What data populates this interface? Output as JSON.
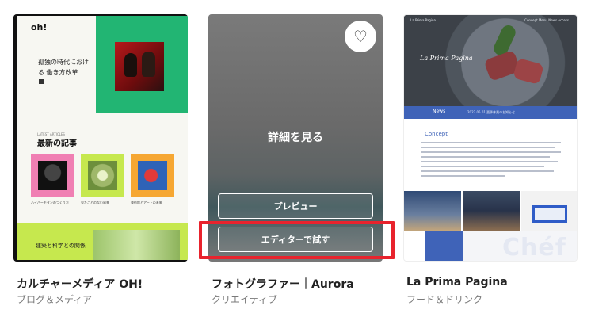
{
  "cards": [
    {
      "title": "カルチャーメディア OH!",
      "category": "ブログ＆メディア",
      "thumb": {
        "logo": "oh!",
        "hero_title": "孤独の時代における 働き方改革",
        "section_label": "LATEST ARTICLES",
        "section_title": "最新の記事",
        "tile_captions": [
          "ハイパーモダンのつくり方",
          "見たことのない風景",
          "美術館とアートの未来"
        ],
        "bottom_title": "建築と科学との関係",
        "colors": {
          "green": "#22b573",
          "pink": "#f07fb3",
          "lime": "#c6e84e",
          "orange": "#f6a733"
        }
      }
    },
    {
      "title": "フォトグラファー｜Aurora",
      "category": "クリエイティブ",
      "thumb": {
        "favorite_icon": "heart-outline-icon",
        "favorite_glyph": "♡",
        "details_label": "詳細を見る",
        "preview_label": "プレビュー",
        "editor_label": "エディターで試す"
      }
    },
    {
      "title": "La Prima Pagina",
      "category": "フード＆ドリンク",
      "thumb": {
        "brand": "La Prima Pagina",
        "nav_left": "La Prima Pagina",
        "nav_right": "Concept   Menu   News   Access",
        "news_label": "News",
        "news_text": "2022.05.01 夏季休業のお知らせ",
        "concept_label": "Concept",
        "watermark": "Chéf",
        "colors": {
          "accent": "#3f63b8"
        }
      }
    }
  ],
  "highlight": {
    "color": "#e8232d",
    "target": "editor_label"
  }
}
